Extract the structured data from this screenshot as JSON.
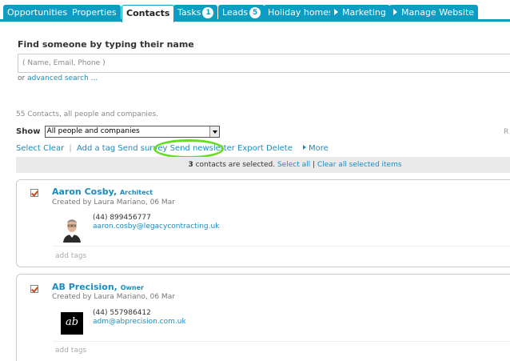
{
  "tabs": [
    {
      "label": "Opportunities",
      "badge": null,
      "arrow": false,
      "active": false
    },
    {
      "label": "Properties",
      "badge": null,
      "arrow": false,
      "active": false
    },
    {
      "label": "Contacts",
      "badge": null,
      "arrow": false,
      "active": true
    },
    {
      "label": "Tasks",
      "badge": "1",
      "arrow": false,
      "active": false
    },
    {
      "label": "Leads",
      "badge": "5",
      "arrow": false,
      "active": false
    },
    {
      "label": "Holiday homes",
      "badge": null,
      "arrow": false,
      "active": false
    },
    {
      "label": "Marketing",
      "badge": null,
      "arrow": true,
      "active": false
    },
    {
      "label": "Manage Website",
      "badge": null,
      "arrow": true,
      "active": false
    }
  ],
  "search": {
    "title": "Find someone by typing their name",
    "placeholder": "( Name, Email, Phone )",
    "or_label": "or",
    "advanced_link": "advanced search ..."
  },
  "contacts_count": "55 Contacts, all people and companies.",
  "filter": {
    "show_label": "Show",
    "selected": "All people and companies",
    "right_fragment": "R"
  },
  "actions": {
    "select": "Select",
    "clear": "Clear",
    "add_tag": "Add a tag",
    "send_survey": "Send survey",
    "send_newsletter": "Send newsletter",
    "export": "Export",
    "delete": "Delete",
    "more": "More"
  },
  "selection_bar": {
    "count": "3",
    "text": "contacts are selected.",
    "select_all": "Select all",
    "clear_all": "Clear all selected items"
  },
  "contacts": [
    {
      "name": "Aaron Cosby",
      "role": "Architect",
      "created": "Created by Laura Mariano, 06 Mar",
      "phone": "(44) 899456777",
      "email": "aaron.cosby@legacycontracting.uk",
      "add_tags": "add tags",
      "avatar": "person-photo"
    },
    {
      "name": "AB Precision",
      "role": "Owner",
      "created": "Created by Laura Mariano, 06 Mar",
      "phone": "(44) 557986412",
      "email": "adm@abprecision.com.uk",
      "add_tags": "add tags",
      "avatar": "company-logo",
      "logo_text": "ab"
    }
  ],
  "colors": {
    "accent": "#0d9cc4",
    "link": "#1a8cc0",
    "highlight_ring": "#66dd22",
    "checkbox_mark": "#d04010"
  }
}
